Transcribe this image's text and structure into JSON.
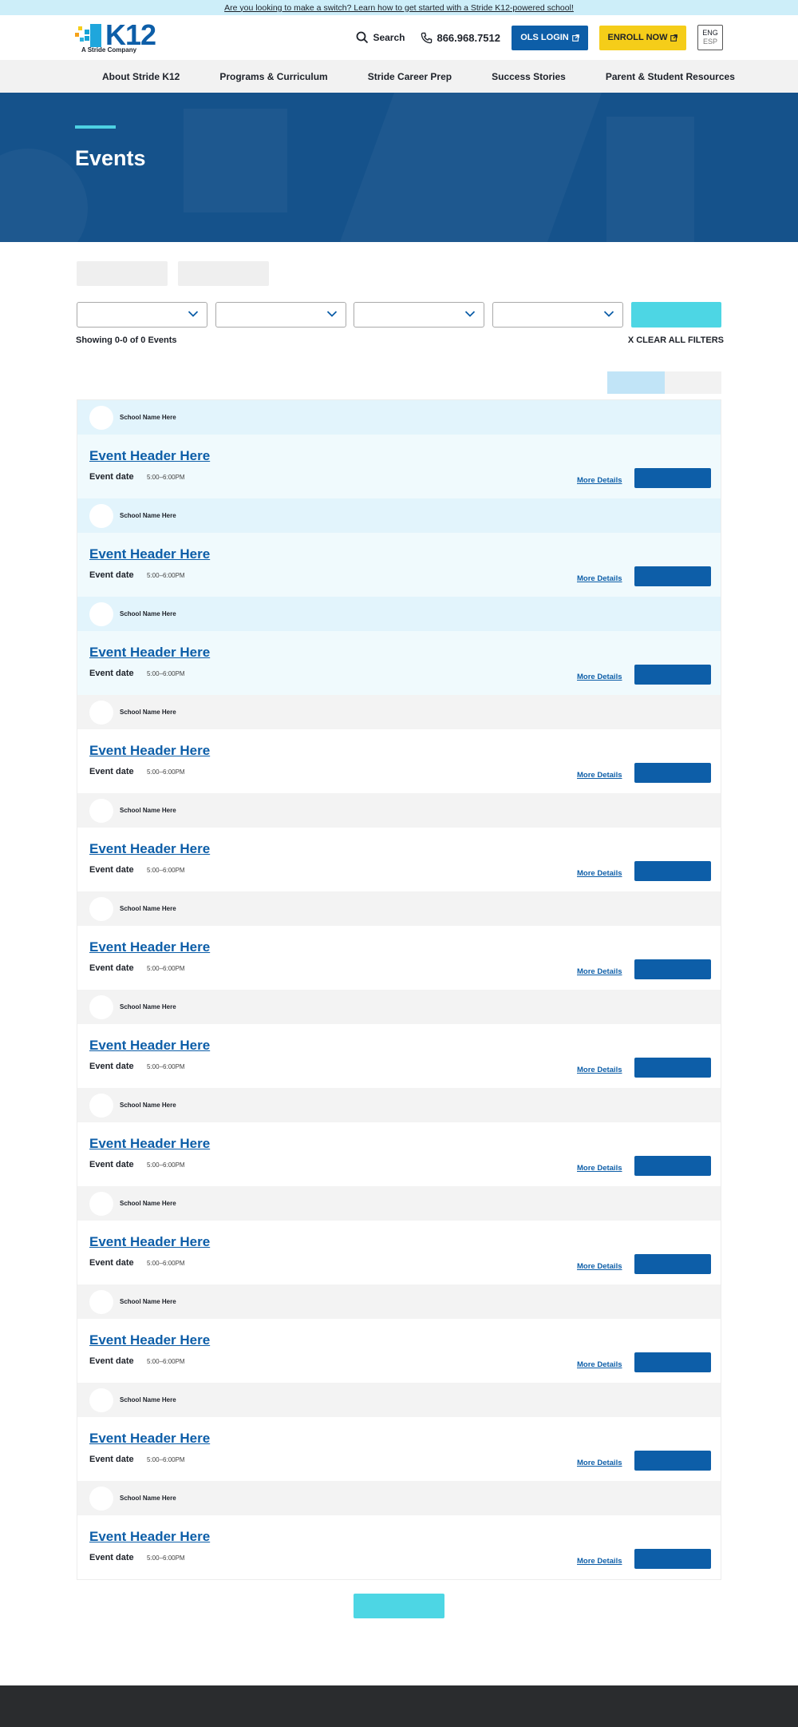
{
  "banner": {
    "text": "Are you looking to make a switch? Learn how to get started with a Stride K12-powered school!"
  },
  "header": {
    "logo_text": "K12",
    "logo_subtitle": "A Stride Company",
    "search_label": "Search",
    "phone": "866.968.7512",
    "ols_login": "OLS LOGIN",
    "enroll_now": "ENROLL NOW",
    "lang_primary": "ENG",
    "lang_secondary": "ESP"
  },
  "nav": {
    "items": [
      "About Stride K12",
      "Programs & Curriculum",
      "Stride Career Prep",
      "Success Stories",
      "Parent & Student Resources"
    ]
  },
  "hero": {
    "title": "Events"
  },
  "filters": {
    "showing": "Showing 0-0 of 0 Events",
    "clear_all": "X CLEAR ALL FILTERS"
  },
  "events": [
    {
      "school": "School Name Here",
      "title": "Event Header Here",
      "date_label": "Event date",
      "time": "5:00–6:00PM",
      "more": "More Details",
      "highlight": true
    },
    {
      "school": "School Name Here",
      "title": "Event Header Here",
      "date_label": "Event date",
      "time": "5:00–6:00PM",
      "more": "More Details",
      "highlight": true
    },
    {
      "school": "School Name Here",
      "title": "Event Header Here",
      "date_label": "Event date",
      "time": "5:00–6:00PM",
      "more": "More Details",
      "highlight": true
    },
    {
      "school": "School Name Here",
      "title": "Event Header Here",
      "date_label": "Event date",
      "time": "5:00–6:00PM",
      "more": "More Details",
      "highlight": false
    },
    {
      "school": "School Name Here",
      "title": "Event Header Here",
      "date_label": "Event date",
      "time": "5:00–6:00PM",
      "more": "More Details",
      "highlight": false
    },
    {
      "school": "School Name Here",
      "title": "Event Header Here",
      "date_label": "Event date",
      "time": "5:00–6:00PM",
      "more": "More Details",
      "highlight": false
    },
    {
      "school": "School Name Here",
      "title": "Event Header Here",
      "date_label": "Event date",
      "time": "5:00–6:00PM",
      "more": "More Details",
      "highlight": false
    },
    {
      "school": "School Name Here",
      "title": "Event Header Here",
      "date_label": "Event date",
      "time": "5:00–6:00PM",
      "more": "More Details",
      "highlight": false
    },
    {
      "school": "School Name Here",
      "title": "Event Header Here",
      "date_label": "Event date",
      "time": "5:00–6:00PM",
      "more": "More Details",
      "highlight": false
    },
    {
      "school": "School Name Here",
      "title": "Event Header Here",
      "date_label": "Event date",
      "time": "5:00–6:00PM",
      "more": "More Details",
      "highlight": false
    },
    {
      "school": "School Name Here",
      "title": "Event Header Here",
      "date_label": "Event date",
      "time": "5:00–6:00PM",
      "more": "More Details",
      "highlight": false
    },
    {
      "school": "School Name Here",
      "title": "Event Header Here",
      "date_label": "Event date",
      "time": "5:00–6:00PM",
      "more": "More Details",
      "highlight": false
    }
  ],
  "colors": {
    "brand_blue": "#0d5ea8",
    "hero_blue": "#15528b",
    "accent_cyan": "#4dd6e4",
    "enroll_yellow": "#f5cd19",
    "highlight_row": "#e2f4fc"
  }
}
